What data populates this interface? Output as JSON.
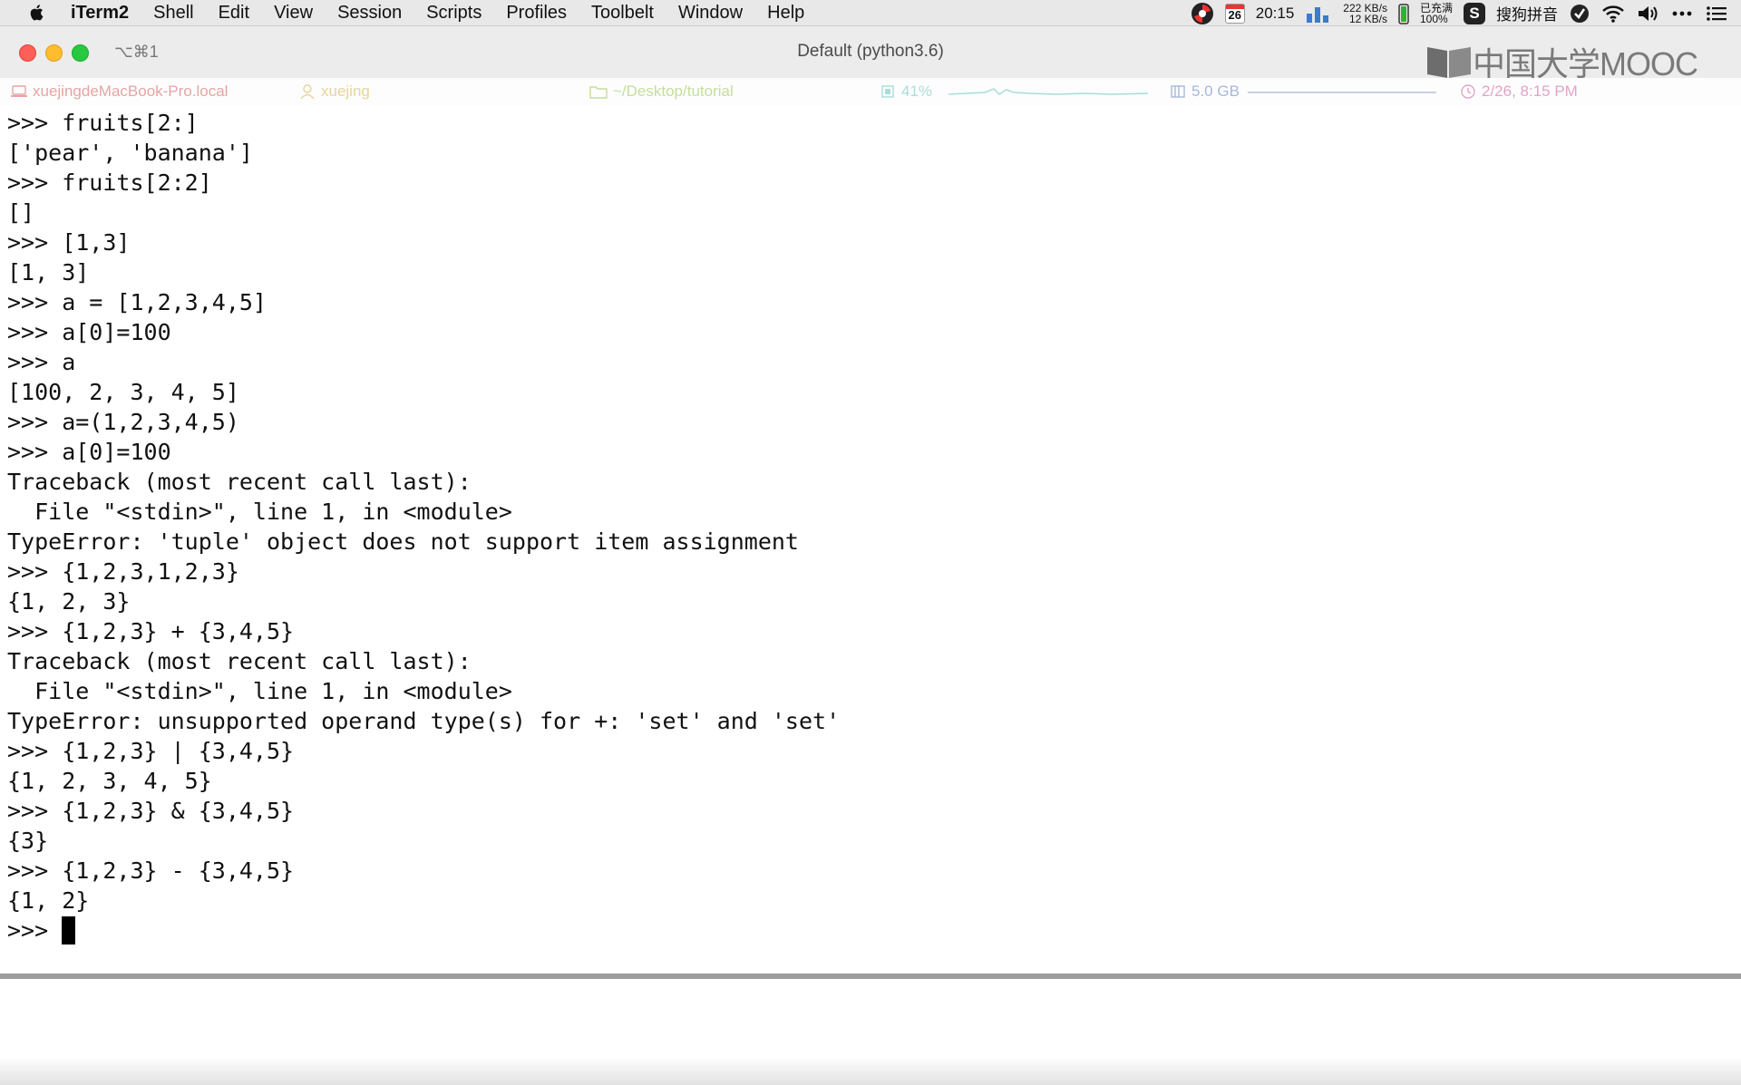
{
  "menubar": {
    "app_name": "iTerm2",
    "items": [
      "Shell",
      "Edit",
      "View",
      "Session",
      "Scripts",
      "Profiles",
      "Toolbelt",
      "Window",
      "Help"
    ],
    "calendar_day": "26",
    "clock": "20:15",
    "net_up": "222 KB/s",
    "net_down": "12 KB/s",
    "battery_status": "已充满",
    "battery_percent": "100%",
    "ime_label": "搜狗拼音",
    "sogou_glyph": "S"
  },
  "window": {
    "tab_shortcut": "⌥⌘1",
    "title": "Default (python3.6)",
    "watermark": "中国大学MOOC"
  },
  "statusbar": {
    "hostname": "xuejingdeMacBook-Pro.local",
    "username": "xuejing",
    "directory": "~/Desktop/tutorial",
    "cpu": "41%",
    "memory": "5.0 GB",
    "datetime": "2/26, 8:15 PM",
    "colors": {
      "host": "#e5a5a5",
      "user": "#e8d39a",
      "dir": "#c4df9b",
      "cpu": "#a9ddd8",
      "mem": "#a7b8dc",
      "clock": "#e3a3c9"
    }
  },
  "terminal": {
    "lines": [
      ">>> fruits[2:]",
      "['pear', 'banana']",
      ">>> fruits[2:2]",
      "[]",
      ">>> [1,3]",
      "[1, 3]",
      ">>> a = [1,2,3,4,5]",
      ">>> a[0]=100",
      ">>> a",
      "[100, 2, 3, 4, 5]",
      ">>> a=(1,2,3,4,5)",
      ">>> a[0]=100",
      "Traceback (most recent call last):",
      "  File \"<stdin>\", line 1, in <module>",
      "TypeError: 'tuple' object does not support item assignment",
      ">>> {1,2,3,1,2,3}",
      "{1, 2, 3}",
      ">>> {1,2,3} + {3,4,5}",
      "Traceback (most recent call last):",
      "  File \"<stdin>\", line 1, in <module>",
      "TypeError: unsupported operand type(s) for +: 'set' and 'set'",
      ">>> {1,2,3} | {3,4,5}",
      "{1, 2, 3, 4, 5}",
      ">>> {1,2,3} & {3,4,5}",
      "{3}",
      ">>> {1,2,3} - {3,4,5}",
      "{1, 2}"
    ],
    "prompt": ">>> "
  }
}
